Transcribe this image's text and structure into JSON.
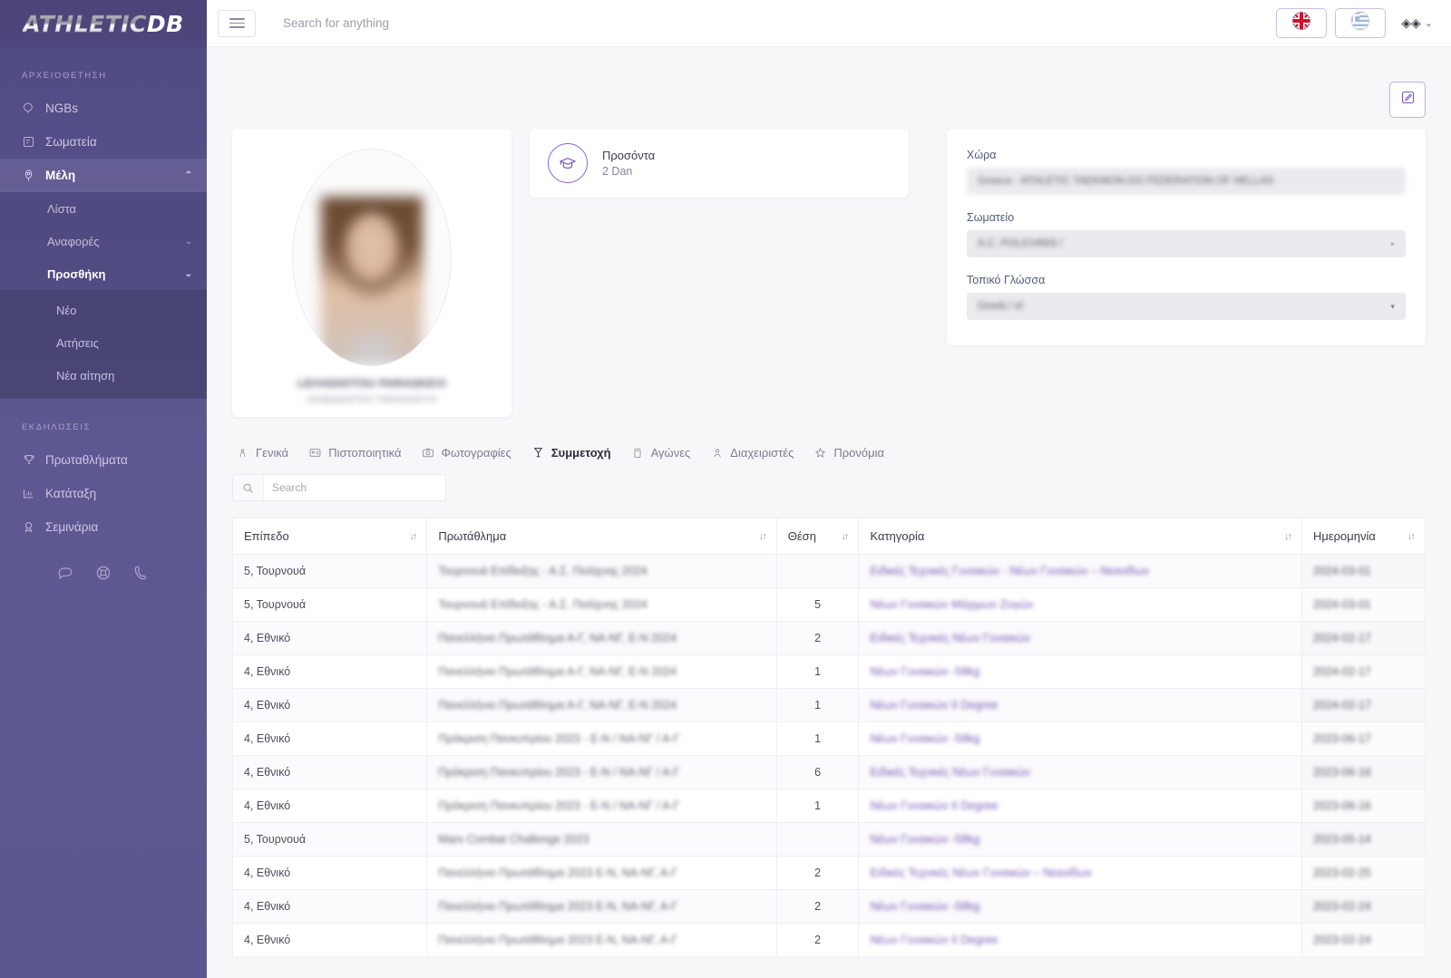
{
  "brand": {
    "part1": "ATHLETIC",
    "part2": "DB"
  },
  "sidebar": {
    "section1_title": "ΑΡΧΕΙΟΘΕΤΗΣΗ",
    "items": [
      {
        "label": "NGBs",
        "icon": "globe-icon"
      },
      {
        "label": "Σωματεία",
        "icon": "building-icon"
      },
      {
        "label": "Μέλη",
        "icon": "person-pin-icon"
      }
    ],
    "sub_items": [
      {
        "label": "Λίστα",
        "icon": "none"
      },
      {
        "label": "Αναφορές",
        "icon": "chevron-down-icon"
      },
      {
        "label": "Προσθήκη",
        "icon": "chevron-down-icon"
      }
    ],
    "sub_sub_items": [
      {
        "label": "Νέο"
      },
      {
        "label": "Αιτήσεις"
      },
      {
        "label": "Νέα αίτηση"
      }
    ],
    "section2_title": "ΕΚΔΗΛΩΣΕΙΣ",
    "items2": [
      {
        "label": "Πρωταθλήματα",
        "icon": "trophy-icon"
      },
      {
        "label": "Κατάταξη",
        "icon": "bar-chart-icon"
      },
      {
        "label": "Σεμινάρια",
        "icon": "award-person-icon"
      }
    ],
    "footer_icons": [
      "chat-icon",
      "lifebuoy-icon",
      "phone-icon"
    ]
  },
  "topbar": {
    "menu_icon": "hamburger-icon",
    "search_placeholder": "Search for anything",
    "search_value": "",
    "lang_primary": "flag-uk-icon",
    "lang_secondary": "flag-greece-icon",
    "user_menu_label": "◈◈",
    "user_menu_caret": "⌄"
  },
  "page": {
    "edit_icon": "edit-square-icon"
  },
  "profile": {
    "name": "LEIVADIOTOU PARASKEVI",
    "name_local": "ΛΕΙΒΑΔΙΩΤΟΥ ΠΑΡΑΣΚΕΥΗ",
    "avatar_icon": "user-photo"
  },
  "qualification": {
    "icon": "graduation-cap-icon",
    "title": "Προσόντα",
    "value": "2 Dan"
  },
  "form": {
    "fields": [
      {
        "label": "Χώρα",
        "value": "Greece - ATHLETIC TAEKWON-DO FEDERATION OF HELLAS",
        "type": "text"
      },
      {
        "label": "Σωματείο",
        "value": "A.C. POLICHNIS /",
        "type": "select",
        "caret": "×"
      },
      {
        "label": "Τοπικό Γλώσσα",
        "value": "Greek / el",
        "type": "select",
        "caret": "▾"
      }
    ]
  },
  "tabs": [
    {
      "label": "Γενικά",
      "icon": "person-icon",
      "active": false
    },
    {
      "label": "Πιστοποιητικά",
      "icon": "id-card-icon",
      "active": false
    },
    {
      "label": "Φωτογραφίες",
      "icon": "camera-icon",
      "active": false
    },
    {
      "label": "Συμμετοχή",
      "icon": "medal-icon",
      "active": true
    },
    {
      "label": "Αγώνες",
      "icon": "ticket-icon",
      "active": false
    },
    {
      "label": "Διαχειριστές",
      "icon": "user-icon",
      "active": false
    },
    {
      "label": "Προνόμια",
      "icon": "star-icon",
      "active": false
    }
  ],
  "table": {
    "search_placeholder": "Search",
    "search_value": "",
    "search_icon": "search-icon",
    "sort_icon": "↓↑",
    "columns": [
      {
        "label": "Επίπεδο",
        "sortable": true
      },
      {
        "label": "Πρωτάθλημα",
        "sortable": true
      },
      {
        "label": "Θέση",
        "sortable": true
      },
      {
        "label": "Κατηγορία",
        "sortable": true
      },
      {
        "label": "Ημερομηνία",
        "sortable": true
      }
    ],
    "rows": [
      {
        "level": "5, Τουρνουά",
        "championship": "Τουρνουά Επίδειξης - Α.Σ. Πολίχνης 2024",
        "position": "",
        "category": "Ειδικές Τεχνικές Γυναικών - Νέων Γυναικών – Νεανίδων",
        "date": "2024-03-01"
      },
      {
        "level": "5, Τουρνουά",
        "championship": "Τουρνουά Επίδειξης - Α.Σ. Πολίχνης 2024",
        "position": "5",
        "category": "Νέων Γυναικών Μάχιμων Ζυγών",
        "date": "2024-03-01"
      },
      {
        "level": "4, Εθνικό",
        "championship": "Πανελλήνιο Πρωτάθλημα Α-Γ, ΝΑ-ΝΓ, Ε-Ν 2024",
        "position": "2",
        "category": "Ειδικές Τεχνικές Νέων Γυναικών",
        "date": "2024-02-17"
      },
      {
        "level": "4, Εθνικό",
        "championship": "Πανελλήνιο Πρωτάθλημα Α-Γ, ΝΑ-ΝΓ, Ε-Ν 2024",
        "position": "1",
        "category": "Νέων Γυναικών -58kg",
        "date": "2024-02-17"
      },
      {
        "level": "4, Εθνικό",
        "championship": "Πανελλήνιο Πρωτάθλημα Α-Γ, ΝΑ-ΝΓ, Ε-Ν 2024",
        "position": "1",
        "category": "Νέων Γυναικών II Degree",
        "date": "2024-02-17"
      },
      {
        "level": "4, Εθνικό",
        "championship": "Πρόκριση Πανκυπρίου 2023 - Ε-Ν / ΝΑ-ΝΓ / Α-Γ",
        "position": "1",
        "category": "Νέων Γυναικών -58kg",
        "date": "2023-06-17"
      },
      {
        "level": "4, Εθνικό",
        "championship": "Πρόκριση Πανκυπρίου 2023 - Ε-Ν / ΝΑ-ΝΓ / Α-Γ",
        "position": "6",
        "category": "Ειδικές Τεχνικές Νέων Γυναικών",
        "date": "2023-06-16"
      },
      {
        "level": "4, Εθνικό",
        "championship": "Πρόκριση Πανκυπρίου 2023 - Ε-Ν / ΝΑ-ΝΓ / Α-Γ",
        "position": "1",
        "category": "Νέων Γυναικών II Degree",
        "date": "2023-06-16"
      },
      {
        "level": "5, Τουρνουά",
        "championship": "Mars Combat Challenge 2023",
        "position": "",
        "category": "Νέων Γυναικών -58kg",
        "date": "2023-05-14"
      },
      {
        "level": "4, Εθνικό",
        "championship": "Πανελλήνιο Πρωτάθλημα 2023 Ε-Ν, ΝΑ-ΝΓ, Α-Γ",
        "position": "2",
        "category": "Ειδικές Τεχνικές Νέων Γυναικών – Νεανίδων",
        "date": "2023-02-25"
      },
      {
        "level": "4, Εθνικό",
        "championship": "Πανελλήνιο Πρωτάθλημα 2023 Ε-Ν, ΝΑ-ΝΓ, Α-Γ",
        "position": "2",
        "category": "Νέων Γυναικών -58kg",
        "date": "2023-02-24"
      },
      {
        "level": "4, Εθνικό",
        "championship": "Πανελλήνιο Πρωτάθλημα 2023 Ε-Ν, ΝΑ-ΝΓ, Α-Γ",
        "position": "2",
        "category": "Νέων Γυναικών II Degree",
        "date": "2023-02-24"
      }
    ]
  }
}
